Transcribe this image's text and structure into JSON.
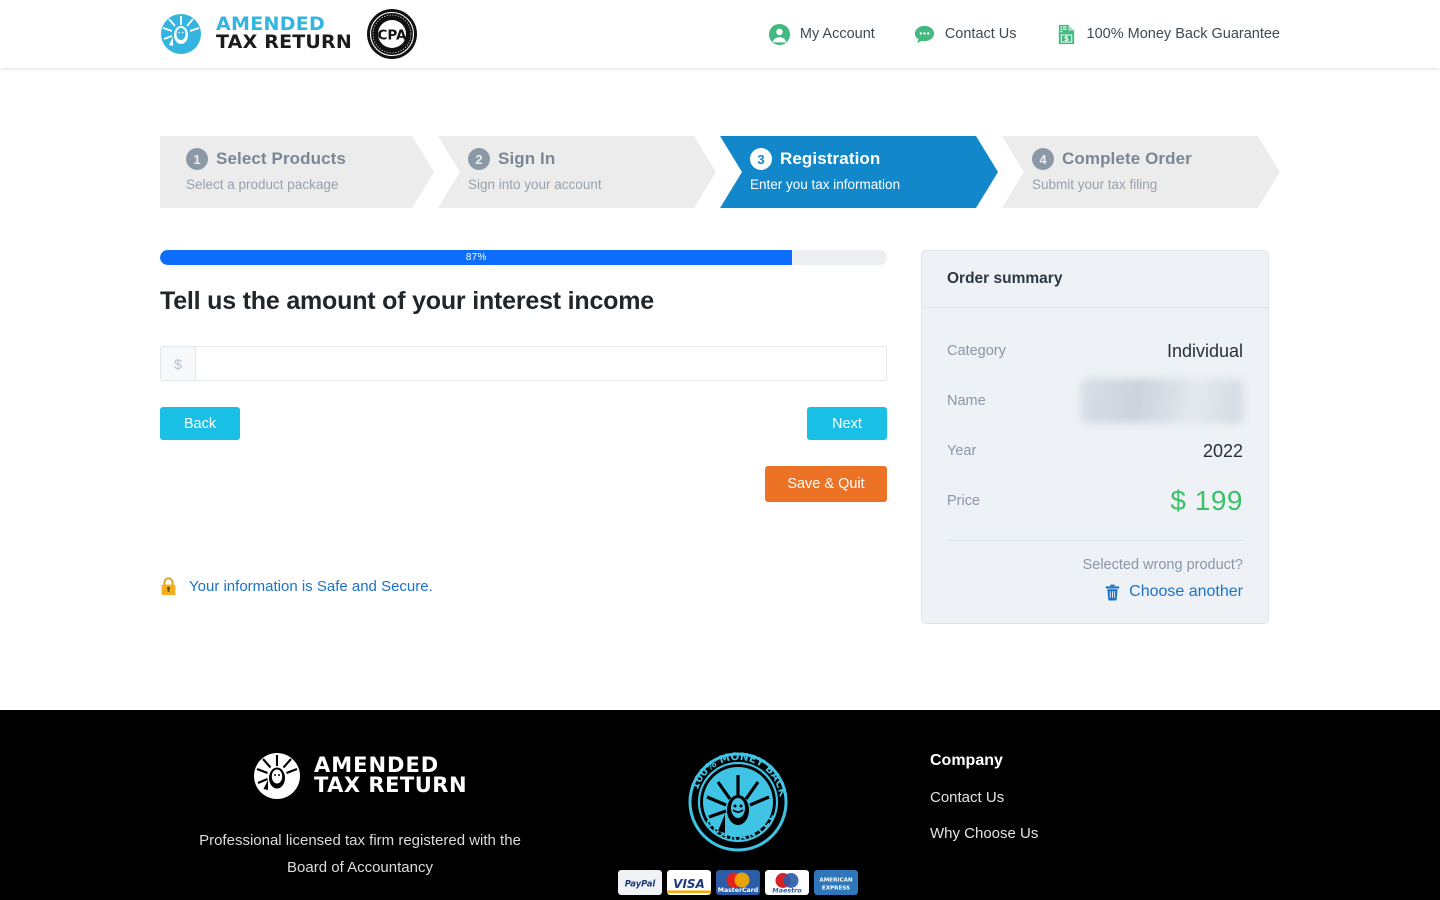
{
  "header": {
    "logo": {
      "line1": "AMENDED",
      "line2": "TAX RETURN",
      "badge": "CPA"
    },
    "nav": [
      {
        "label": "My Account",
        "icon": "user-circle-icon"
      },
      {
        "label": "Contact Us",
        "icon": "chat-bubble-icon"
      },
      {
        "label": "100% Money Back Guarantee",
        "icon": "money-document-icon"
      }
    ]
  },
  "steps": [
    {
      "num": "1",
      "title": "Select Products",
      "sub": "Select a product package",
      "active": false
    },
    {
      "num": "2",
      "title": "Sign In",
      "sub": "Sign into your account",
      "active": false
    },
    {
      "num": "3",
      "title": "Registration",
      "sub": "Enter you tax information",
      "active": true
    },
    {
      "num": "4",
      "title": "Complete Order",
      "sub": "Submit your tax filing",
      "active": false
    }
  ],
  "form": {
    "progress_percent": 87,
    "progress_label": "87%",
    "question": "Tell us the amount of your interest income",
    "currency_symbol": "$",
    "amount_value": "",
    "amount_placeholder": "",
    "back_label": "Back",
    "next_label": "Next",
    "save_quit_label": "Save & Quit",
    "secure_text": "Your information is Safe and Secure."
  },
  "summary": {
    "heading": "Order summary",
    "rows": [
      {
        "label": "Category",
        "value": "Individual",
        "redacted": false
      },
      {
        "label": "Name",
        "value": "",
        "redacted": true
      },
      {
        "label": "Year",
        "value": "2022",
        "redacted": false
      },
      {
        "label": "Price",
        "value": "$ 199",
        "redacted": false
      }
    ],
    "wrong_product_text": "Selected wrong product?",
    "choose_another_label": "Choose another"
  },
  "footer": {
    "logo": {
      "line1": "AMENDED",
      "line2": "TAX RETURN"
    },
    "tagline_line1": "Professional licensed tax firm registered with the",
    "tagline_line2": "Board of Accountancy",
    "guarantee_badge": "100% MONEY BACK GUARANTEE",
    "payments": [
      "PayPal",
      "VISA",
      "MasterCard",
      "Maestro",
      "AMERICAN EXPRESS"
    ],
    "company_heading": "Company",
    "company_links": [
      "Contact Us",
      "Why Choose Us"
    ]
  },
  "colors": {
    "accent_blue": "#1287c9",
    "progress_blue": "#0d6efd",
    "cyan_button": "#19bfe5",
    "orange_button": "#ec7225",
    "price_green": "#3fbf6a",
    "link_blue": "#1a73c9",
    "brand_cyan": "#33b5e0",
    "footer_bg": "#000000",
    "summary_bg": "#eef1f6"
  }
}
